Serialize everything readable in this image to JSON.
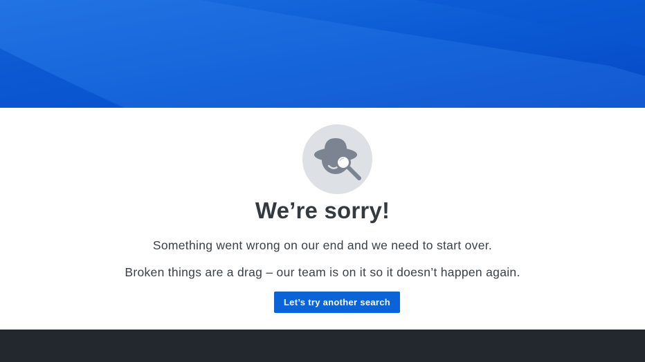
{
  "hero": {
    "background_color": "#0a5bd6",
    "highlight_color": "#2f7ae8"
  },
  "error": {
    "icon": "detective-magnifier-icon",
    "title": "We’re sorry!",
    "message_line_1": "Something went wrong on our end and we need to start over.",
    "message_line_2": "Broken things are a drag – our team is on it so it doesn’t happen again.",
    "button_label": "Let’s try another search"
  },
  "colors": {
    "accent": "#0a64d8",
    "icon_circle": "#dde1e5",
    "icon_glyph": "#7b8490",
    "title_text": "#343a40",
    "footer": "#23272e"
  }
}
